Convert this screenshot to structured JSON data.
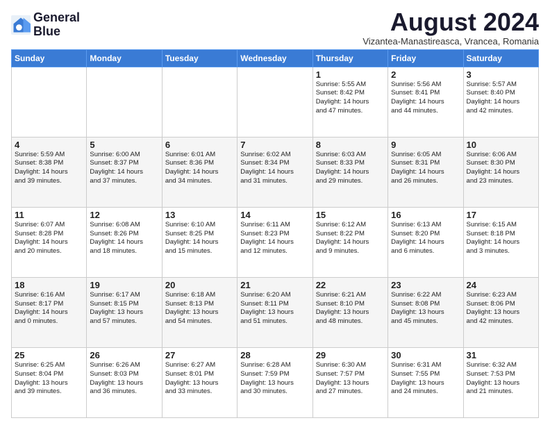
{
  "logo": {
    "line1": "General",
    "line2": "Blue"
  },
  "title": {
    "month_year": "August 2024",
    "location": "Vizantea-Manastireasca, Vrancea, Romania"
  },
  "weekdays": [
    "Sunday",
    "Monday",
    "Tuesday",
    "Wednesday",
    "Thursday",
    "Friday",
    "Saturday"
  ],
  "weeks": [
    [
      {
        "day": "",
        "info": ""
      },
      {
        "day": "",
        "info": ""
      },
      {
        "day": "",
        "info": ""
      },
      {
        "day": "",
        "info": ""
      },
      {
        "day": "1",
        "info": "Sunrise: 5:55 AM\nSunset: 8:42 PM\nDaylight: 14 hours\nand 47 minutes."
      },
      {
        "day": "2",
        "info": "Sunrise: 5:56 AM\nSunset: 8:41 PM\nDaylight: 14 hours\nand 44 minutes."
      },
      {
        "day": "3",
        "info": "Sunrise: 5:57 AM\nSunset: 8:40 PM\nDaylight: 14 hours\nand 42 minutes."
      }
    ],
    [
      {
        "day": "4",
        "info": "Sunrise: 5:59 AM\nSunset: 8:38 PM\nDaylight: 14 hours\nand 39 minutes."
      },
      {
        "day": "5",
        "info": "Sunrise: 6:00 AM\nSunset: 8:37 PM\nDaylight: 14 hours\nand 37 minutes."
      },
      {
        "day": "6",
        "info": "Sunrise: 6:01 AM\nSunset: 8:36 PM\nDaylight: 14 hours\nand 34 minutes."
      },
      {
        "day": "7",
        "info": "Sunrise: 6:02 AM\nSunset: 8:34 PM\nDaylight: 14 hours\nand 31 minutes."
      },
      {
        "day": "8",
        "info": "Sunrise: 6:03 AM\nSunset: 8:33 PM\nDaylight: 14 hours\nand 29 minutes."
      },
      {
        "day": "9",
        "info": "Sunrise: 6:05 AM\nSunset: 8:31 PM\nDaylight: 14 hours\nand 26 minutes."
      },
      {
        "day": "10",
        "info": "Sunrise: 6:06 AM\nSunset: 8:30 PM\nDaylight: 14 hours\nand 23 minutes."
      }
    ],
    [
      {
        "day": "11",
        "info": "Sunrise: 6:07 AM\nSunset: 8:28 PM\nDaylight: 14 hours\nand 20 minutes."
      },
      {
        "day": "12",
        "info": "Sunrise: 6:08 AM\nSunset: 8:26 PM\nDaylight: 14 hours\nand 18 minutes."
      },
      {
        "day": "13",
        "info": "Sunrise: 6:10 AM\nSunset: 8:25 PM\nDaylight: 14 hours\nand 15 minutes."
      },
      {
        "day": "14",
        "info": "Sunrise: 6:11 AM\nSunset: 8:23 PM\nDaylight: 14 hours\nand 12 minutes."
      },
      {
        "day": "15",
        "info": "Sunrise: 6:12 AM\nSunset: 8:22 PM\nDaylight: 14 hours\nand 9 minutes."
      },
      {
        "day": "16",
        "info": "Sunrise: 6:13 AM\nSunset: 8:20 PM\nDaylight: 14 hours\nand 6 minutes."
      },
      {
        "day": "17",
        "info": "Sunrise: 6:15 AM\nSunset: 8:18 PM\nDaylight: 14 hours\nand 3 minutes."
      }
    ],
    [
      {
        "day": "18",
        "info": "Sunrise: 6:16 AM\nSunset: 8:17 PM\nDaylight: 14 hours\nand 0 minutes."
      },
      {
        "day": "19",
        "info": "Sunrise: 6:17 AM\nSunset: 8:15 PM\nDaylight: 13 hours\nand 57 minutes."
      },
      {
        "day": "20",
        "info": "Sunrise: 6:18 AM\nSunset: 8:13 PM\nDaylight: 13 hours\nand 54 minutes."
      },
      {
        "day": "21",
        "info": "Sunrise: 6:20 AM\nSunset: 8:11 PM\nDaylight: 13 hours\nand 51 minutes."
      },
      {
        "day": "22",
        "info": "Sunrise: 6:21 AM\nSunset: 8:10 PM\nDaylight: 13 hours\nand 48 minutes."
      },
      {
        "day": "23",
        "info": "Sunrise: 6:22 AM\nSunset: 8:08 PM\nDaylight: 13 hours\nand 45 minutes."
      },
      {
        "day": "24",
        "info": "Sunrise: 6:23 AM\nSunset: 8:06 PM\nDaylight: 13 hours\nand 42 minutes."
      }
    ],
    [
      {
        "day": "25",
        "info": "Sunrise: 6:25 AM\nSunset: 8:04 PM\nDaylight: 13 hours\nand 39 minutes."
      },
      {
        "day": "26",
        "info": "Sunrise: 6:26 AM\nSunset: 8:03 PM\nDaylight: 13 hours\nand 36 minutes."
      },
      {
        "day": "27",
        "info": "Sunrise: 6:27 AM\nSunset: 8:01 PM\nDaylight: 13 hours\nand 33 minutes."
      },
      {
        "day": "28",
        "info": "Sunrise: 6:28 AM\nSunset: 7:59 PM\nDaylight: 13 hours\nand 30 minutes."
      },
      {
        "day": "29",
        "info": "Sunrise: 6:30 AM\nSunset: 7:57 PM\nDaylight: 13 hours\nand 27 minutes."
      },
      {
        "day": "30",
        "info": "Sunrise: 6:31 AM\nSunset: 7:55 PM\nDaylight: 13 hours\nand 24 minutes."
      },
      {
        "day": "31",
        "info": "Sunrise: 6:32 AM\nSunset: 7:53 PM\nDaylight: 13 hours\nand 21 minutes."
      }
    ]
  ]
}
